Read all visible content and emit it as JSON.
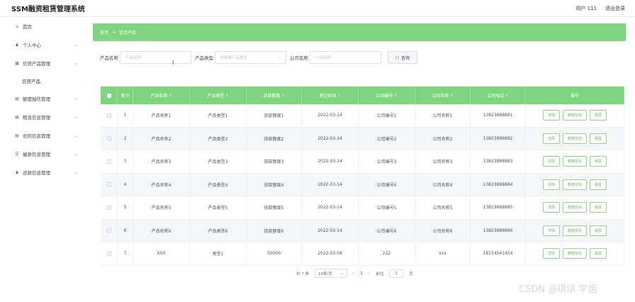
{
  "app": {
    "title": "SSM融资租赁管理系统",
    "user": "用户 111",
    "logout": "退出登录"
  },
  "sidebar": {
    "items": [
      {
        "icon": "home-icon",
        "glyph": "⌂",
        "label": "首页",
        "expandable": false
      },
      {
        "icon": "user-icon",
        "glyph": "♟",
        "label": "个人中心",
        "expandable": true
      },
      {
        "icon": "grid-icon",
        "glyph": "▦",
        "label": "信贷产品管理",
        "expandable": true
      },
      {
        "icon": "list-icon",
        "glyph": "▤",
        "label": "额度授信管理",
        "expandable": true
      },
      {
        "icon": "list-icon",
        "glyph": "▤",
        "label": "租赁信息管理",
        "expandable": true
      },
      {
        "icon": "doc-icon",
        "glyph": "▤",
        "label": "合同信息管理",
        "expandable": true
      },
      {
        "icon": "doc-icon",
        "glyph": "☰",
        "label": "催款信息管理",
        "expandable": true
      },
      {
        "icon": "user-icon",
        "glyph": "♟",
        "label": "还款信息管理",
        "expandable": true
      }
    ],
    "sub_item": "信贷产品"
  },
  "breadcrumb": {
    "home": "首页",
    "sep": "→",
    "current": "信贷产品"
  },
  "search": {
    "name_label": "产品名称",
    "name_placeholder": "产品名称",
    "type_label": "产品类型",
    "type_placeholder": "请选择产品类型",
    "company_label": "公司名称",
    "company_placeholder": "公司名称",
    "button": "查询"
  },
  "table": {
    "headers": [
      "索引",
      "产品名称",
      "产品类型",
      "放款额度",
      "登记时间",
      "公司编号",
      "公司名称",
      "公司电话",
      "操作"
    ],
    "rows": [
      [
        "1",
        "产品名称1",
        "产品类型1",
        "放款额度1",
        "2022-03-14",
        "公司编号1",
        "公司名称1",
        "13823888881"
      ],
      [
        "2",
        "产品名称2",
        "产品类型2",
        "放款额度2",
        "2022-03-14",
        "公司编号2",
        "公司名称2",
        "13823888882"
      ],
      [
        "3",
        "产品名称3",
        "产品类型3",
        "放款额度3",
        "2022-03-14",
        "公司编号3",
        "公司名称3",
        "13823888883"
      ],
      [
        "4",
        "产品名称4",
        "产品类型4",
        "放款额度4",
        "2022-03-14",
        "公司编号4",
        "公司名称4",
        "13823888884"
      ],
      [
        "5",
        "产品名称5",
        "产品类型5",
        "放款额度5",
        "2022-03-14",
        "公司编号5",
        "公司名称5",
        "13823888885"
      ],
      [
        "6",
        "产品名称6",
        "产品类型6",
        "放款额度6",
        "2022-03-14",
        "公司编号6",
        "公司名称6",
        "13823888886"
      ],
      [
        "7",
        "XXX",
        "类型1",
        "50000",
        "2022-03-08",
        "222",
        "xxx",
        "18154541454"
      ]
    ],
    "actions": [
      "详情",
      "额度授信",
      "租赁"
    ]
  },
  "pager": {
    "total": "共 7 条",
    "size": "10条/页",
    "prev": "‹",
    "page": "1",
    "next": "›",
    "goto": "前往",
    "goto_value": "1",
    "page_unit": "页"
  },
  "watermark": "CSDN @琪琪 学姐",
  "colors": {
    "accent": "#7fd47f",
    "button_text": "#5cb85c"
  }
}
